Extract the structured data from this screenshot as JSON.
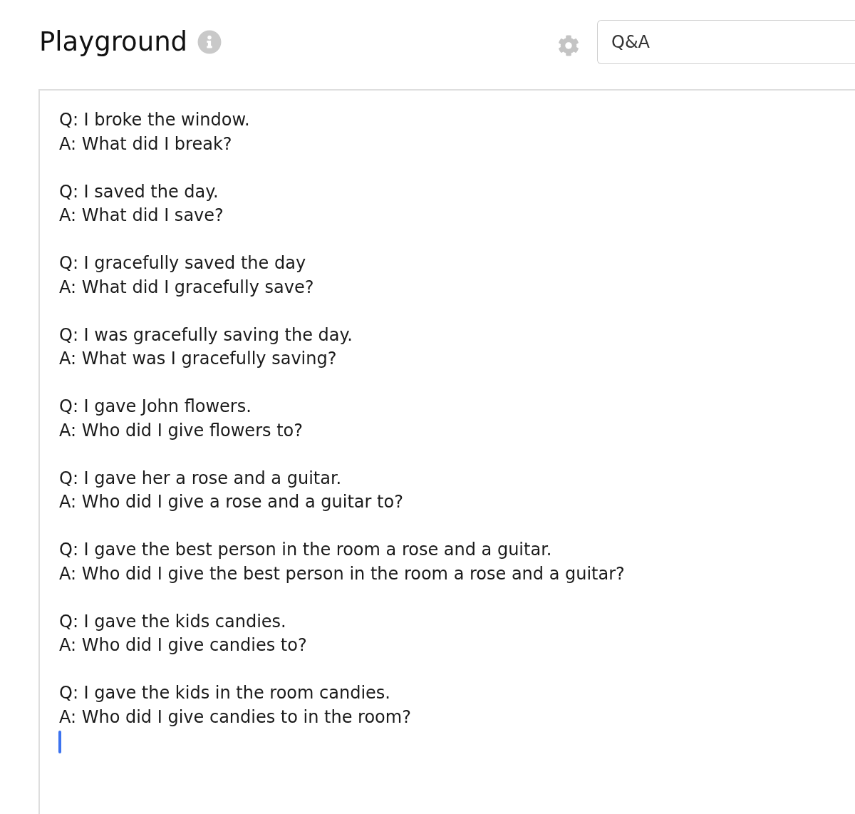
{
  "header": {
    "title": "Playground",
    "preset": {
      "value": "Q&A"
    }
  },
  "editor": {
    "focused": true,
    "pairs": [
      {
        "question": "Q: I broke the window.",
        "answer": "A: What did I break?"
      },
      {
        "question": "Q: I saved the day.",
        "answer": "A: What did I save?"
      },
      {
        "question": "Q: I gracefully saved the day",
        "answer": "A: What did I gracefully save?"
      },
      {
        "question": "Q: I was gracefully saving the day.",
        "answer": "A: What was I gracefully saving?"
      },
      {
        "question": "Q: I gave John flowers.",
        "answer": "A: Who did I give flowers to?"
      },
      {
        "question": "Q: I gave her a rose and a guitar.",
        "answer": "A: Who did I give a rose and a guitar to?"
      },
      {
        "question": "Q: I gave the best person in the room a rose and a guitar.",
        "answer": "A: Who did I give the best person in the room a rose and a guitar?"
      },
      {
        "question": "Q: I gave the kids candies.",
        "answer": "A: Who did I give candies to?"
      },
      {
        "question": "Q: I gave the kids in the room candies.",
        "answer": "A: Who did I give candies to in the room?"
      }
    ]
  }
}
